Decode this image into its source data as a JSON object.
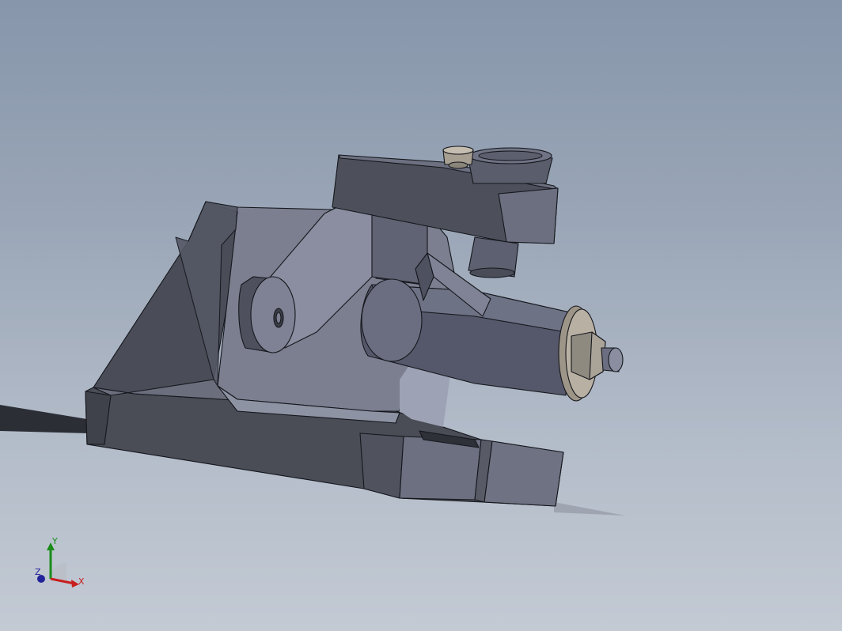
{
  "viewport": {
    "model": "cad-assembly-clamp",
    "background_top": "#8796ab",
    "background_bottom": "#c3cad4"
  },
  "triad": {
    "x_label": "X",
    "y_label": "Y",
    "z_label": "Z",
    "x_color": "#c81e1e",
    "y_color": "#1a8c1a",
    "z_color": "#22229a"
  }
}
